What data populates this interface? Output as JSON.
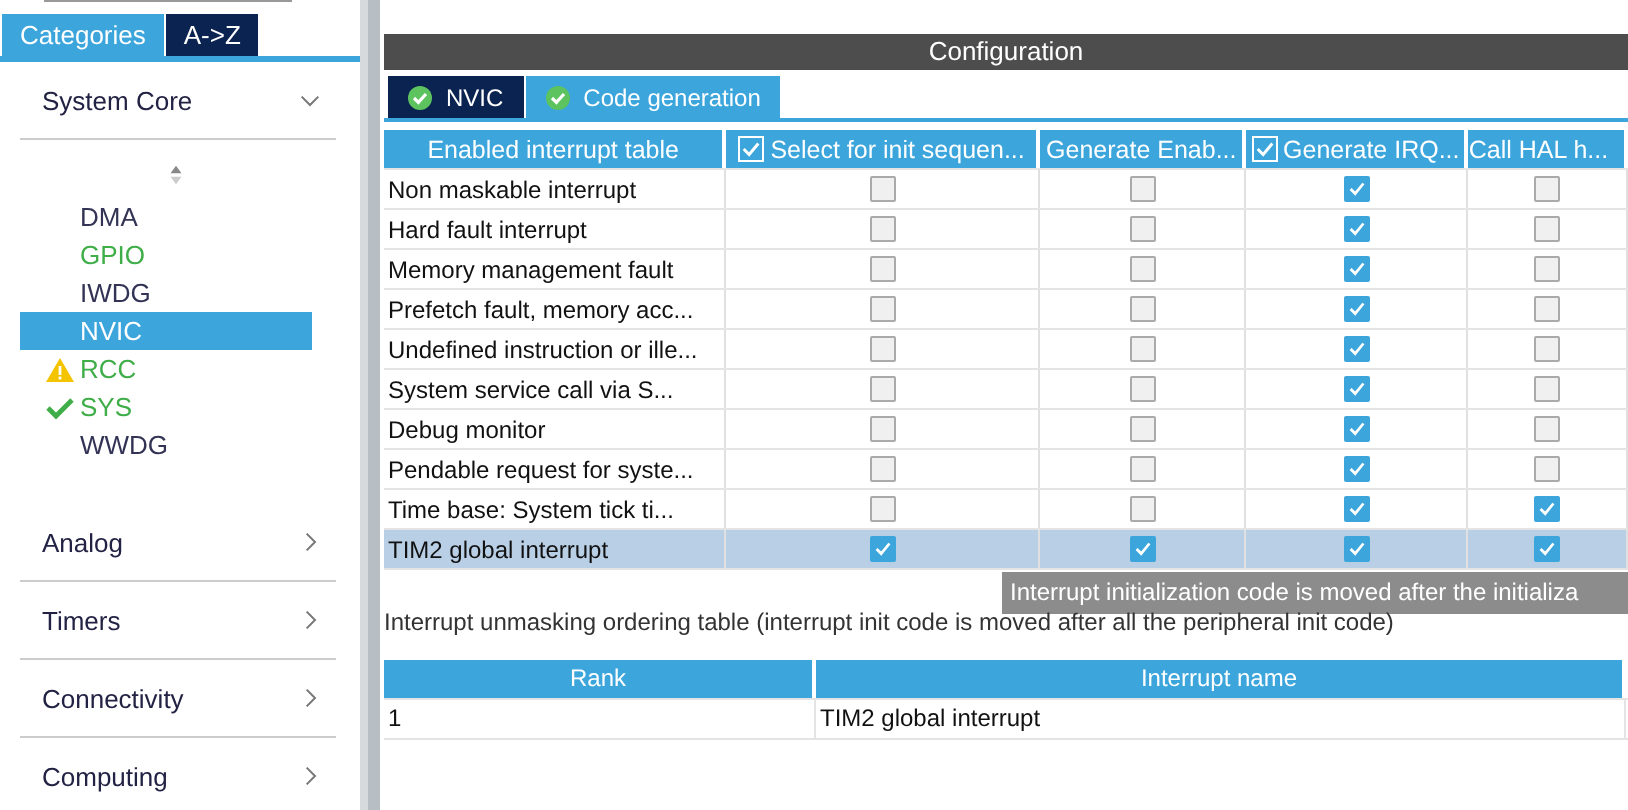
{
  "sidebar": {
    "tabs": [
      {
        "label": "Categories",
        "selected": true
      },
      {
        "label": "A->Z",
        "selected": false
      }
    ],
    "categories": [
      {
        "label": "System Core",
        "expanded": true,
        "items": [
          {
            "label": "DMA",
            "selected": false,
            "color": "#333355",
            "kind": "plain"
          },
          {
            "label": "GPIO",
            "selected": false,
            "color": "#3fae49",
            "kind": "plain"
          },
          {
            "label": "IWDG",
            "selected": false,
            "color": "#333355",
            "kind": "plain"
          },
          {
            "label": "NVIC",
            "selected": true,
            "kind": "plain"
          },
          {
            "label": "RCC",
            "selected": false,
            "color": "#3fae49",
            "kind": "warning"
          },
          {
            "label": "SYS",
            "selected": false,
            "color": "#3fae49",
            "kind": "ok"
          },
          {
            "label": "WWDG",
            "selected": false,
            "color": "#333355",
            "kind": "plain"
          }
        ]
      },
      {
        "label": "Analog",
        "expanded": false
      },
      {
        "label": "Timers",
        "expanded": false
      },
      {
        "label": "Connectivity",
        "expanded": false
      },
      {
        "label": "Computing",
        "expanded": false
      }
    ]
  },
  "configuration": {
    "title": "Configuration",
    "tabs": [
      {
        "label": "NVIC",
        "selected": false
      },
      {
        "label": "Code generation",
        "selected": true
      }
    ],
    "interrupt_table": {
      "columns": [
        {
          "label": "Enabled interrupt table",
          "kind": "plain"
        },
        {
          "label": "Select for init sequen...",
          "kind": "checkbox",
          "checked": true
        },
        {
          "label": "Generate Enab...",
          "kind": "plain"
        },
        {
          "label": "Generate IRQ...",
          "kind": "checkbox",
          "checked": true
        },
        {
          "label": "Call HAL h...",
          "kind": "plain"
        }
      ],
      "rows": [
        {
          "name": "Non maskable interrupt",
          "selected": false,
          "checks": [
            false,
            false,
            true,
            false
          ]
        },
        {
          "name": "Hard fault interrupt",
          "selected": false,
          "checks": [
            false,
            false,
            true,
            false
          ]
        },
        {
          "name": "Memory management fault",
          "selected": false,
          "checks": [
            false,
            false,
            true,
            false
          ]
        },
        {
          "name": "Prefetch fault, memory acc...",
          "selected": false,
          "checks": [
            false,
            false,
            true,
            false
          ]
        },
        {
          "name": "Undefined instruction or ille...",
          "selected": false,
          "checks": [
            false,
            false,
            true,
            false
          ]
        },
        {
          "name": "System service call via S...",
          "selected": false,
          "checks": [
            false,
            false,
            true,
            false
          ]
        },
        {
          "name": "Debug monitor",
          "selected": false,
          "checks": [
            false,
            false,
            true,
            false
          ]
        },
        {
          "name": "Pendable request for syste...",
          "selected": false,
          "checks": [
            false,
            false,
            true,
            false
          ]
        },
        {
          "name": "Time base: System tick ti...",
          "selected": false,
          "checks": [
            false,
            false,
            true,
            true
          ]
        },
        {
          "name": "TIM2 global interrupt",
          "selected": true,
          "checks": [
            true,
            true,
            true,
            true
          ]
        }
      ]
    },
    "tooltip": "Interrupt initialization code is moved after the initializa",
    "ordering_caption": "Interrupt unmasking ordering table (interrupt init code is moved after all the peripheral init code)",
    "ordering_table": {
      "columns": [
        "Rank",
        "Interrupt name"
      ],
      "rows": [
        [
          "1",
          "TIM2 global interrupt"
        ]
      ]
    }
  }
}
